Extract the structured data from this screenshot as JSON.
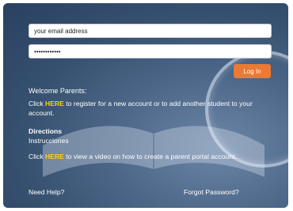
{
  "login": {
    "email_value": "your email address",
    "password_value": "••••••••••••",
    "login_button": "Log In"
  },
  "content": {
    "welcome": "Welcome Parents:",
    "register_prefix": "Click ",
    "register_link": "HERE",
    "register_suffix": " to register for a new account or to add another student to your account.",
    "directions_title": "Directions",
    "directions_subtitle": "Instrucciones",
    "video_prefix": "Click ",
    "video_link": "HERE",
    "video_suffix": " to view a video on how to create a parent portal account."
  },
  "footer": {
    "need_help": "Need Help?",
    "forgot_password": "Forgot Password?"
  },
  "colors": {
    "accent": "#ea7a34",
    "link": "#ffd400",
    "background": "#36506f"
  }
}
